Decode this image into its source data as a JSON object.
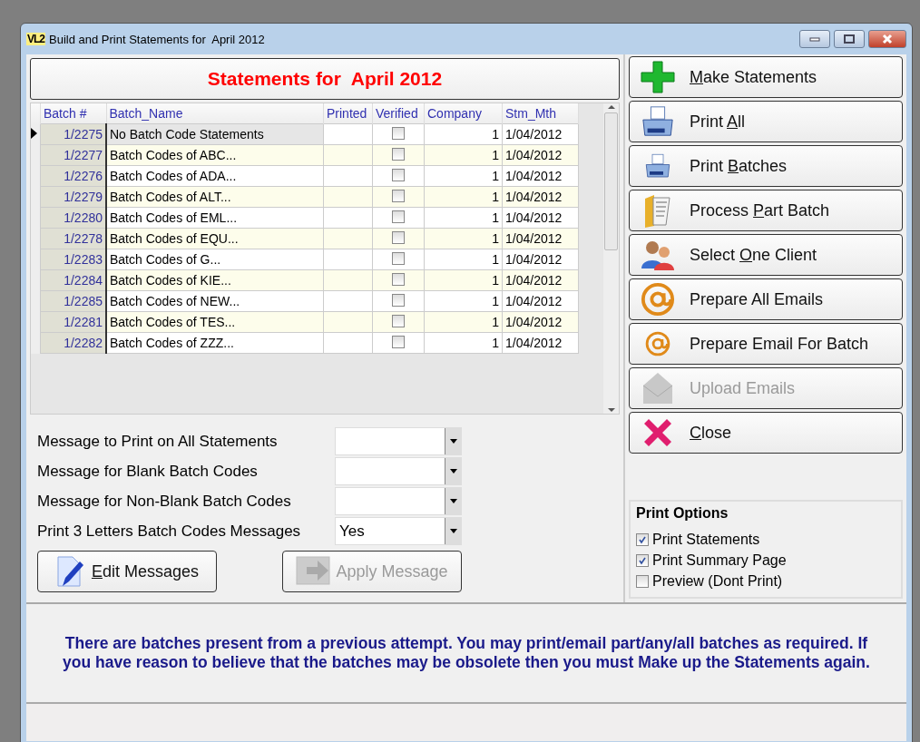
{
  "window": {
    "logo": "VL2",
    "title": "Build and Print Statements for  April 2012"
  },
  "heading": "Statements for  April 2012",
  "table": {
    "columns": [
      "Batch #",
      "Batch_Name",
      "Printed",
      "Verified",
      "Company",
      "Stm_Mth"
    ],
    "rows": [
      {
        "batch": "1/2275",
        "name": "No Batch Code Statements",
        "verified": false,
        "company": "1",
        "stm_mth": "1/04/2012",
        "selected": true
      },
      {
        "batch": "1/2277",
        "name": "Batch Codes of ABC...",
        "verified": false,
        "company": "1",
        "stm_mth": "1/04/2012",
        "selected": false
      },
      {
        "batch": "1/2276",
        "name": "Batch Codes of ADA...",
        "verified": false,
        "company": "1",
        "stm_mth": "1/04/2012",
        "selected": false
      },
      {
        "batch": "1/2279",
        "name": "Batch Codes of ALT...",
        "verified": false,
        "company": "1",
        "stm_mth": "1/04/2012",
        "selected": false
      },
      {
        "batch": "1/2280",
        "name": "Batch Codes of EML...",
        "verified": false,
        "company": "1",
        "stm_mth": "1/04/2012",
        "selected": false
      },
      {
        "batch": "1/2278",
        "name": "Batch Codes of EQU...",
        "verified": false,
        "company": "1",
        "stm_mth": "1/04/2012",
        "selected": false
      },
      {
        "batch": "1/2283",
        "name": "Batch Codes of G...",
        "verified": false,
        "company": "1",
        "stm_mth": "1/04/2012",
        "selected": false
      },
      {
        "batch": "1/2284",
        "name": "Batch Codes of KIE...",
        "verified": false,
        "company": "1",
        "stm_mth": "1/04/2012",
        "selected": false
      },
      {
        "batch": "1/2285",
        "name": "Batch Codes of NEW...",
        "verified": false,
        "company": "1",
        "stm_mth": "1/04/2012",
        "selected": false
      },
      {
        "batch": "1/2281",
        "name": "Batch Codes of TES...",
        "verified": false,
        "company": "1",
        "stm_mth": "1/04/2012",
        "selected": false
      },
      {
        "batch": "1/2282",
        "name": "Batch Codes of ZZZ...",
        "verified": false,
        "company": "1",
        "stm_mth": "1/04/2012",
        "selected": false
      }
    ]
  },
  "messages": [
    {
      "label": "Message to Print on All Statements"
    },
    {
      "label": "Message for Blank Batch Codes"
    },
    {
      "label": "Message for Non-Blank Batch Codes"
    },
    {
      "label": "Print 3 Letters Batch Codes Messages",
      "value": "Yes"
    }
  ],
  "message_buttons": [
    {
      "kind": "edit",
      "hotkey": "E",
      "after": "dit Messages",
      "disabled": false
    },
    {
      "kind": "apply",
      "before": "Apply Message",
      "disabled": true
    }
  ],
  "actions": [
    {
      "kind": "plus",
      "hotkey": "M",
      "after": "ake Statements",
      "disabled": false
    },
    {
      "kind": "printer",
      "before": "Print ",
      "hotkey": "A",
      "after": "ll",
      "disabled": false
    },
    {
      "kind": "printer-small",
      "before": "Print ",
      "hotkey": "B",
      "after": "atches",
      "disabled": false
    },
    {
      "kind": "folder",
      "before": "Process ",
      "hotkey": "P",
      "after": "art Batch",
      "disabled": false
    },
    {
      "kind": "people",
      "before": "Select ",
      "hotkey": "O",
      "after": "ne Client",
      "disabled": false
    },
    {
      "kind": "at",
      "before": "Prepare All Emails",
      "disabled": false
    },
    {
      "kind": "at-small",
      "before": "Prepare Email For Batch",
      "disabled": false
    },
    {
      "kind": "envelope",
      "before": "Upload Emails",
      "disabled": true
    },
    {
      "kind": "cross",
      "hotkey": "C",
      "after": "lose",
      "disabled": false
    }
  ],
  "print_options": {
    "title": "Print Options",
    "items": [
      {
        "label": "Print Statements",
        "checked": true
      },
      {
        "label": "Print Summary Page",
        "checked": true
      },
      {
        "label": "Preview (Dont Print)",
        "checked": false
      }
    ]
  },
  "notice": "There are batches present from a previous attempt.  You may print/email part/any/all batches as required.  If you have reason to believe that the batches may be obsolete then you must Make up the Statements again."
}
